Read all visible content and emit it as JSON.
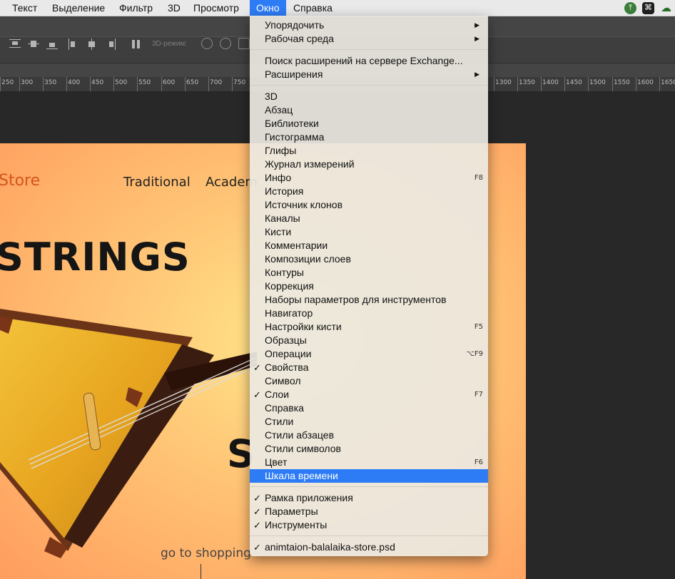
{
  "menubar": {
    "items": [
      {
        "label": "Текст"
      },
      {
        "label": "Выделение"
      },
      {
        "label": "Фильтр"
      },
      {
        "label": "3D"
      },
      {
        "label": "Просмотр"
      },
      {
        "label": "Окно"
      },
      {
        "label": "Справка"
      }
    ],
    "active_item": "Окно",
    "accent_color": "#2d7cf6"
  },
  "options_bar": {
    "mode_label": "3D-режим:"
  },
  "ruler": {
    "left_ticks": [
      "250",
      "300",
      "350",
      "400",
      "450",
      "500",
      "550",
      "600",
      "650",
      "700",
      "750"
    ],
    "right_ticks": [
      "1300",
      "1350",
      "1400",
      "1450",
      "1500",
      "1550",
      "1600",
      "1650"
    ]
  },
  "document": {
    "logo": "Store",
    "nav": [
      "Traditional",
      "Academ"
    ],
    "headline": "STRINGS",
    "big_letter": "S",
    "shop_link": "go to shopping"
  },
  "window_menu": {
    "group1": [
      {
        "label": "Упорядочить",
        "submenu": true
      },
      {
        "label": "Рабочая среда",
        "submenu": true
      }
    ],
    "group2": [
      {
        "label": "Поиск расширений на сервере Exchange..."
      },
      {
        "label": "Расширения",
        "submenu": true
      }
    ],
    "group3": [
      {
        "label": "3D"
      },
      {
        "label": "Абзац"
      },
      {
        "label": "Библиотеки"
      },
      {
        "label": "Гистограмма"
      },
      {
        "label": "Глифы"
      },
      {
        "label": "Журнал измерений"
      },
      {
        "label": "Инфо",
        "shortcut": "F8"
      },
      {
        "label": "История"
      },
      {
        "label": "Источник клонов"
      },
      {
        "label": "Каналы"
      },
      {
        "label": "Кисти"
      },
      {
        "label": "Комментарии"
      },
      {
        "label": "Композиции слоев"
      },
      {
        "label": "Контуры"
      },
      {
        "label": "Коррекция"
      },
      {
        "label": "Наборы параметров для инструментов"
      },
      {
        "label": "Навигатор"
      },
      {
        "label": "Настройки кисти",
        "shortcut": "F5"
      },
      {
        "label": "Образцы"
      },
      {
        "label": "Операции",
        "shortcut": "⌥F9"
      },
      {
        "label": "Свойства",
        "checked": true
      },
      {
        "label": "Символ"
      },
      {
        "label": "Слои",
        "checked": true,
        "shortcut": "F7"
      },
      {
        "label": "Справка"
      },
      {
        "label": "Стили"
      },
      {
        "label": "Стили абзацев"
      },
      {
        "label": "Стили символов"
      },
      {
        "label": "Цвет",
        "shortcut": "F6"
      },
      {
        "label": "Шкала времени",
        "highlighted": true
      }
    ],
    "group4": [
      {
        "label": "Рамка приложения",
        "checked": true
      },
      {
        "label": "Параметры",
        "checked": true
      },
      {
        "label": "Инструменты",
        "checked": true
      }
    ],
    "group5": [
      {
        "label": "animtaion-balalaika-store.psd",
        "checked": true
      }
    ]
  }
}
